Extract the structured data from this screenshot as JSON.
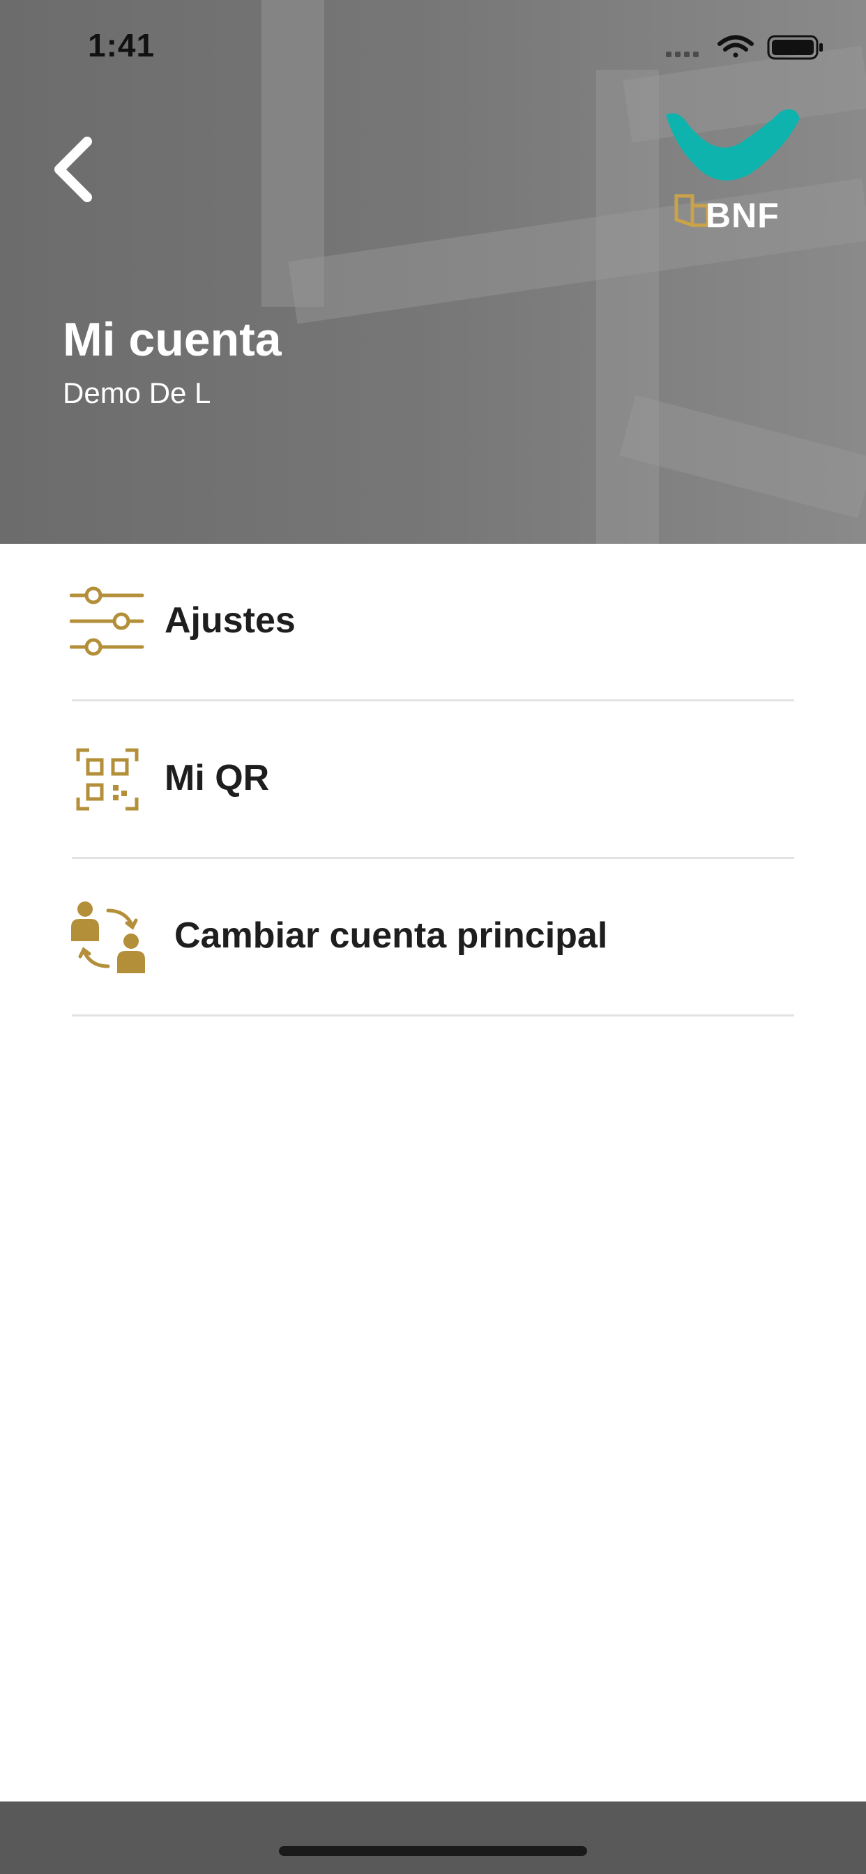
{
  "status_bar": {
    "time": "1:41",
    "icons": [
      "signal-dots-icon",
      "wifi-icon",
      "battery-icon"
    ]
  },
  "header": {
    "back_icon": "chevron-left-icon",
    "logo_text": "BNF",
    "title": "Mi cuenta",
    "subtitle": "Demo De L"
  },
  "menu": {
    "items": [
      {
        "label": "Ajustes",
        "icon": "sliders-icon"
      },
      {
        "label": "Mi QR",
        "icon": "qr-code-icon"
      },
      {
        "label": "Cambiar cuenta principal",
        "icon": "switch-account-icon"
      }
    ]
  },
  "colors": {
    "accent": "#b38f3a",
    "brand_teal": "#0fb3ad",
    "header_gray": "#777777",
    "text": "#1e1e1e",
    "divider": "#e3e3e3"
  }
}
